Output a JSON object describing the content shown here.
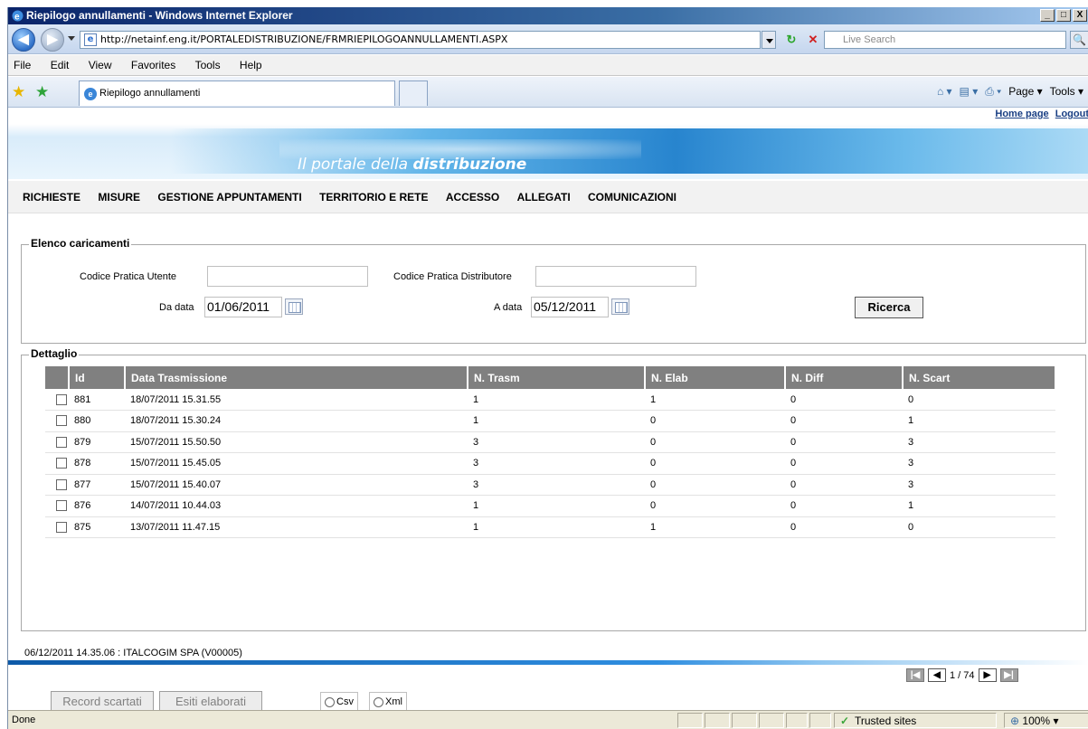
{
  "window": {
    "title": "Riepilogo annullamenti - Windows Internet Explorer",
    "controls": {
      "minimize": "_",
      "maximize": "□",
      "close": "X"
    }
  },
  "addressbar": {
    "url": "http://netainf.eng.it/PORTALEDISTRIBUZIONE/FRMRIEPILOGOANNULLAMENTI.ASPX",
    "search_placeholder": "Live Search",
    "back_glyph": "◀",
    "forward_glyph": "▶",
    "refresh_glyph": "↻",
    "stop_glyph": "✕",
    "search_glyph": "🔍"
  },
  "menubar": [
    "File",
    "Edit",
    "View",
    "Favorites",
    "Tools",
    "Help"
  ],
  "tabs": {
    "active_label": "Riepilogo annullamenti"
  },
  "commandbar": {
    "page_label": "Page",
    "tools_label": "Tools"
  },
  "portal": {
    "title_prefix": "Il portale della ",
    "title_bold": "distribuzione",
    "home_link": "Home page",
    "logout_link": "Logout"
  },
  "nav": [
    "RICHIESTE",
    "MISURE",
    "GESTIONE APPUNTAMENTI",
    "TERRITORIO E RETE",
    "ACCESSO",
    "ALLEGATI",
    "COMUNICAZIONI"
  ],
  "search_form": {
    "legend": "Elenco caricamenti",
    "codice_utente_label": "Codice Pratica Utente",
    "codice_utente_value": "",
    "codice_distributore_label": "Codice Pratica Distributore",
    "codice_distributore_value": "",
    "da_data_label": "Da data",
    "da_data_value": "01/06/2011",
    "a_data_label": "A data",
    "a_data_value": "05/12/2011",
    "search_button": "Ricerca"
  },
  "detail": {
    "legend": "Dettaglio",
    "columns": [
      "Id",
      "Data Trasmissione",
      "N. Trasm",
      "N. Elab",
      "N. Diff",
      "N. Scart"
    ],
    "rows": [
      [
        "881",
        "18/07/2011 15.31.55",
        "1",
        "1",
        "0",
        "0"
      ],
      [
        "880",
        "18/07/2011 15.30.24",
        "1",
        "0",
        "0",
        "1"
      ],
      [
        "879",
        "15/07/2011 15.50.50",
        "3",
        "0",
        "0",
        "3"
      ],
      [
        "878",
        "15/07/2011 15.45.05",
        "3",
        "0",
        "0",
        "3"
      ],
      [
        "877",
        "15/07/2011 15.40.07",
        "3",
        "0",
        "0",
        "3"
      ],
      [
        "876",
        "14/07/2011 10.44.03",
        "1",
        "0",
        "0",
        "1"
      ],
      [
        "875",
        "13/07/2011 11.47.15",
        "1",
        "1",
        "0",
        "0"
      ]
    ],
    "pager_text": "1 / 74",
    "record_scartati_button": "Record scartati",
    "esiti_elaborati_button": "Esiti elaborati",
    "format_csv": "Csv",
    "format_xml": "Xml"
  },
  "footer": {
    "info": "06/12/2011 14.35.06  :  ITALCOGIM SPA  (V00005)"
  },
  "statusbar": {
    "status": "Done",
    "zone": "Trusted sites",
    "zoom": "100%"
  }
}
